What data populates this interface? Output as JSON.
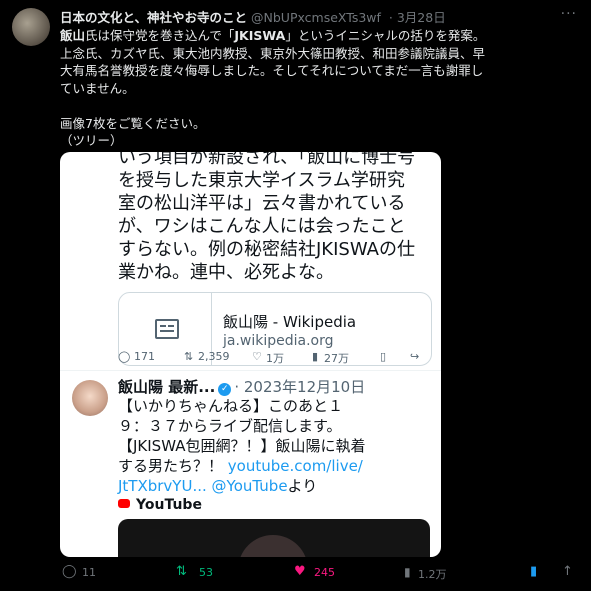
{
  "tweet": {
    "author_name": "日本の文化と、神社やお寺のこと",
    "handle": "@NbUPxcmseXTs3wf",
    "date": "· 3月28日",
    "more": "···",
    "body": {
      "line1_bold": "飯山",
      "line1_rest_a": "氏は保守党を巻き込んで「",
      "line1_bold2": "JKISWA",
      "line1_rest_b": "」というイニシャルの括りを発案。",
      "line2": "上念氏、カズヤ氏、東大池内教授、東京外大篠田教授、和田参議院議員、早",
      "line3": "大有馬名誉教授を度々侮辱しました。そしてそれについてまだ一言も謝罪し",
      "line4": "ていません。",
      "line5": "画像7枚をご覧ください。",
      "line6": "（ツリー）"
    },
    "actions": {
      "replies": "11",
      "retweets": "53",
      "likes": "245",
      "views": "1.2万"
    }
  },
  "screenshot": {
    "upper_text": [
      "いう項目が新設され、「飯山に博士号",
      "を授与した東京大学イスラム学研究",
      "室の松山洋平は」云々書かれている",
      "が、ワシはこんな人には会ったこと",
      "すらない。例の秘密結社JKISWAの仕",
      "業かね。連中、必死よな。"
    ],
    "card": {
      "title": "飯山陽 - Wikipedia",
      "domain": "ja.wikipedia.org"
    },
    "upper_actions": {
      "replies": "171",
      "retweets": "2,359",
      "likes": "1万",
      "views": "27万"
    },
    "second_tweet": {
      "name": "飯山陽 最新...",
      "date": "· 2023年12月10日",
      "line1": "【いかりちゃんねる】このあと１",
      "line2": "９：３７からライブ配信します。",
      "line3": "【JKISWA包囲網？！】飯山陽に執着",
      "line4": "する男たち？！",
      "link1": "youtube.com/live/",
      "link2": "JtTXbrvYU...",
      "link3": "@YouTube",
      "line5_tail": "より",
      "youtube_label": "YouTube"
    }
  },
  "colors": {
    "background": "#000000",
    "text": "#e7e9ea",
    "muted": "#71767b",
    "link": "#1d9bf0",
    "retweet_green": "#00ba7c",
    "like_pink": "#f91880"
  }
}
